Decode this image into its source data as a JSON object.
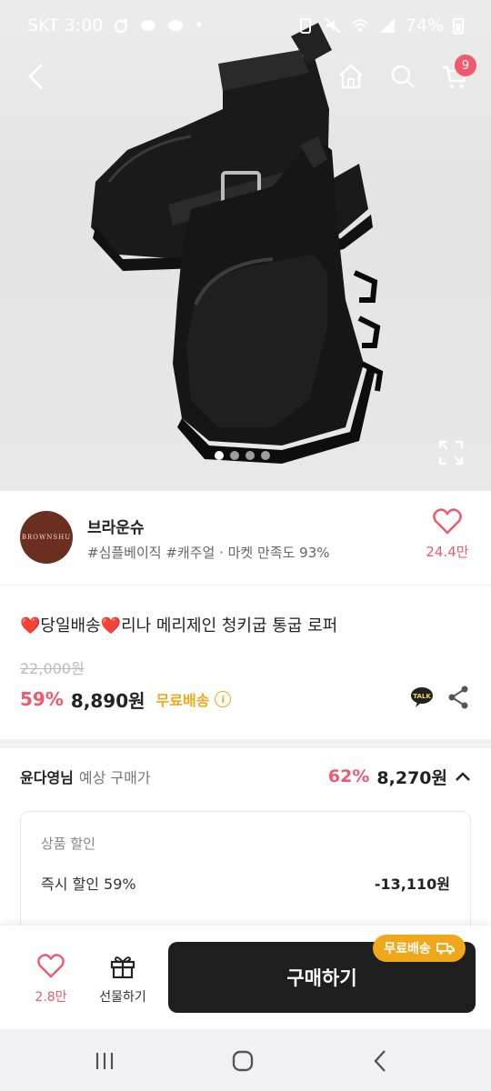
{
  "status": {
    "carrier_time": "SKT 3:00",
    "battery": "74%"
  },
  "nav": {
    "cart_count": "9"
  },
  "gallery": {
    "total": 4,
    "active": 0
  },
  "shop": {
    "logo_text": "BROWNSHU",
    "name": "브라운슈",
    "tags": "#심플베이직 #캐주얼 · 마켓 만족도 93%",
    "likes": "24.4만"
  },
  "product": {
    "title": "❤️당일배송❤️리나 메리제인 청키굽 통굽 로퍼",
    "original_price": "22,000원",
    "discount_rate": "59%",
    "price": "8,890원",
    "free_shipping": "무료배송",
    "info_icon": "i"
  },
  "member": {
    "name": "윤다영님",
    "label": "예상 구매가",
    "discount_rate": "62%",
    "price": "8,270원"
  },
  "discount_detail": {
    "title": "상품 할인",
    "label": "즉시 할인 59%",
    "value": "-13,110원"
  },
  "bottom": {
    "like_count": "2.8만",
    "gift_label": "선물하기",
    "buy_label": "구매하기",
    "free_tag": "무료배송"
  },
  "colors": {
    "accent": "#ef5a6f",
    "badge_orange": "#f0a81a",
    "buy_button": "#1e1e1e"
  }
}
